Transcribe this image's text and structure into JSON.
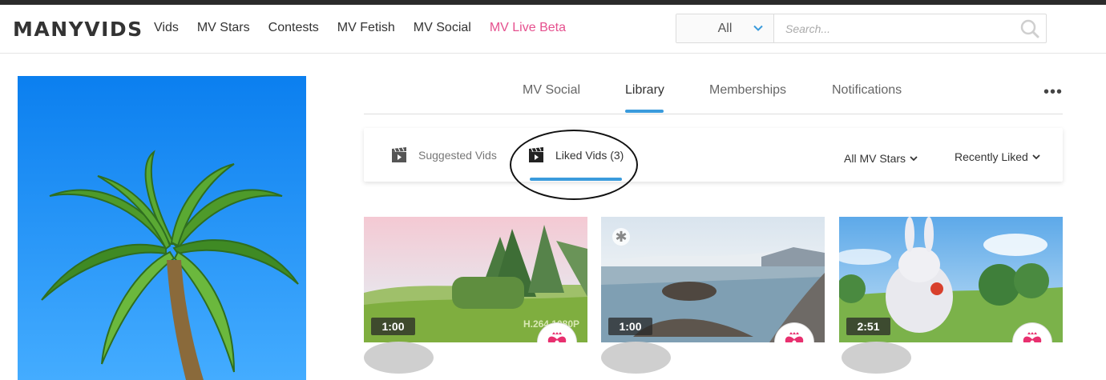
{
  "brand": {
    "logo_text": "MANYVIDS"
  },
  "nav": {
    "items": [
      {
        "label": "Vids"
      },
      {
        "label": "MV Stars"
      },
      {
        "label": "Contests"
      },
      {
        "label": "MV Fetish"
      },
      {
        "label": "MV Social"
      },
      {
        "label": "MV Live Beta"
      }
    ],
    "live_color": "#e5508e"
  },
  "search": {
    "category_selected": "All",
    "placeholder": "Search...",
    "icon": "search-icon"
  },
  "main_tabs": {
    "items": [
      {
        "label": "MV Social"
      },
      {
        "label": "Library"
      },
      {
        "label": "Memberships"
      },
      {
        "label": "Notifications"
      }
    ],
    "active": "Library",
    "more_label": "•••"
  },
  "sub_tabs": {
    "items": [
      {
        "label": "Suggested Vids",
        "icon": "clapperboard-icon"
      },
      {
        "label": "Liked Vids (3)",
        "icon": "clapperboard-icon"
      }
    ],
    "active": "Liked Vids (3)"
  },
  "filters": {
    "stars_filter": "All MV Stars",
    "sort_filter": "Recently Liked"
  },
  "videos": [
    {
      "duration": "1:00",
      "watermark": "H.264 1080P"
    },
    {
      "duration": "1:00"
    },
    {
      "duration": "2:51"
    }
  ],
  "colors": {
    "accent_blue": "#3a9bdc",
    "brand_pink": "#e5508e",
    "heart_pink": "#e8306f"
  }
}
